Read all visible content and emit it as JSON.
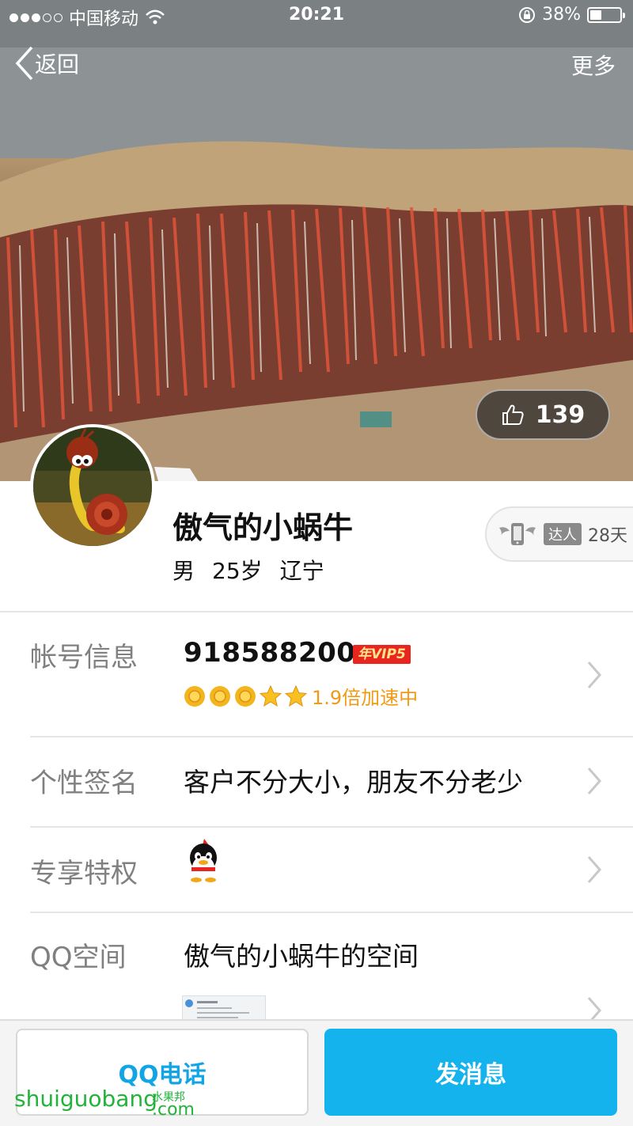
{
  "status_bar": {
    "carrier": "中国移动",
    "time": "20:21",
    "battery": "38%",
    "battery_level": 0.38
  },
  "nav": {
    "back_label": "返回",
    "more_label": "更多"
  },
  "cover": {
    "like_count": "139"
  },
  "profile": {
    "nickname": "傲气的小蜗牛",
    "gender": "男",
    "age": "25岁",
    "location": "辽宁",
    "daren_tag": "达人",
    "daren_days": "28天"
  },
  "rows": {
    "account": {
      "label": "帐号信息",
      "qq_number": "918588200",
      "vip_badge": "年VIP5",
      "accel_text": "1.9倍加速中",
      "level_icons": [
        "sun-icon",
        "sun-icon",
        "sun-icon",
        "star-icon",
        "star-icon"
      ]
    },
    "signature": {
      "label": "个性签名",
      "value": "客户不分大小，朋友不分老少"
    },
    "privilege": {
      "label": "专享特权"
    },
    "qzone": {
      "label": "QQ空间",
      "value": "傲气的小蜗牛的空间"
    }
  },
  "buttons": {
    "call": "QQ电话",
    "message": "发消息"
  },
  "watermark": {
    "main": "shuiguobang",
    "small": "水果邦",
    "suffix": ".com"
  },
  "colors": {
    "accent": "#14b3ee",
    "call_text": "#12a5e6",
    "accel": "#f09a16",
    "vip_red": "#e8261f",
    "watermark": "#22b33a"
  }
}
